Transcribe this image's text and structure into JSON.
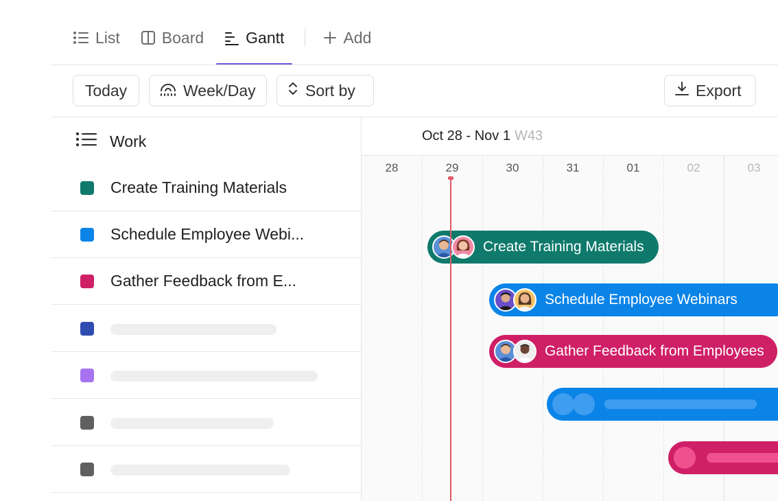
{
  "tabs": [
    {
      "label": "List",
      "icon": "list-icon",
      "active": false
    },
    {
      "label": "Board",
      "icon": "board-icon",
      "active": false
    },
    {
      "label": "Gantt",
      "icon": "gantt-icon",
      "active": true
    },
    {
      "label": "Add",
      "icon": "plus-icon",
      "active": false
    }
  ],
  "toolbar": {
    "today_label": "Today",
    "weekday_label": "Week/Day",
    "sortby_label": "Sort by",
    "export_label": "Export"
  },
  "left_panel": {
    "header": "Work",
    "rows": [
      {
        "title": "Create Training Materials",
        "color": "#0f7a6c"
      },
      {
        "title": "Schedule Employee Webi...",
        "color": "#0b84e8"
      },
      {
        "title": "Gather Feedback from E...",
        "color": "#cf1f66"
      },
      {
        "title": "",
        "color": "#2f4cb0"
      },
      {
        "title": "",
        "color": "#a873f0"
      },
      {
        "title": "",
        "color": "#5f5f5f"
      },
      {
        "title": "",
        "color": "#5f5f5f"
      }
    ]
  },
  "gantt": {
    "week_range": "Oct 28 - Nov 1",
    "week_number": "W43",
    "days": [
      "28",
      "29",
      "30",
      "31",
      "01",
      "02",
      "03"
    ],
    "bars": [
      {
        "label": "Create Training Materials",
        "color": "#0f7a6c"
      },
      {
        "label": "Schedule Employee Webinars",
        "color": "#0b84e8"
      },
      {
        "label": "Gather Feedback from Employees",
        "color": "#cf1f66"
      }
    ],
    "today_color": "#e05a67",
    "accent_color": "#6a5bdc"
  }
}
